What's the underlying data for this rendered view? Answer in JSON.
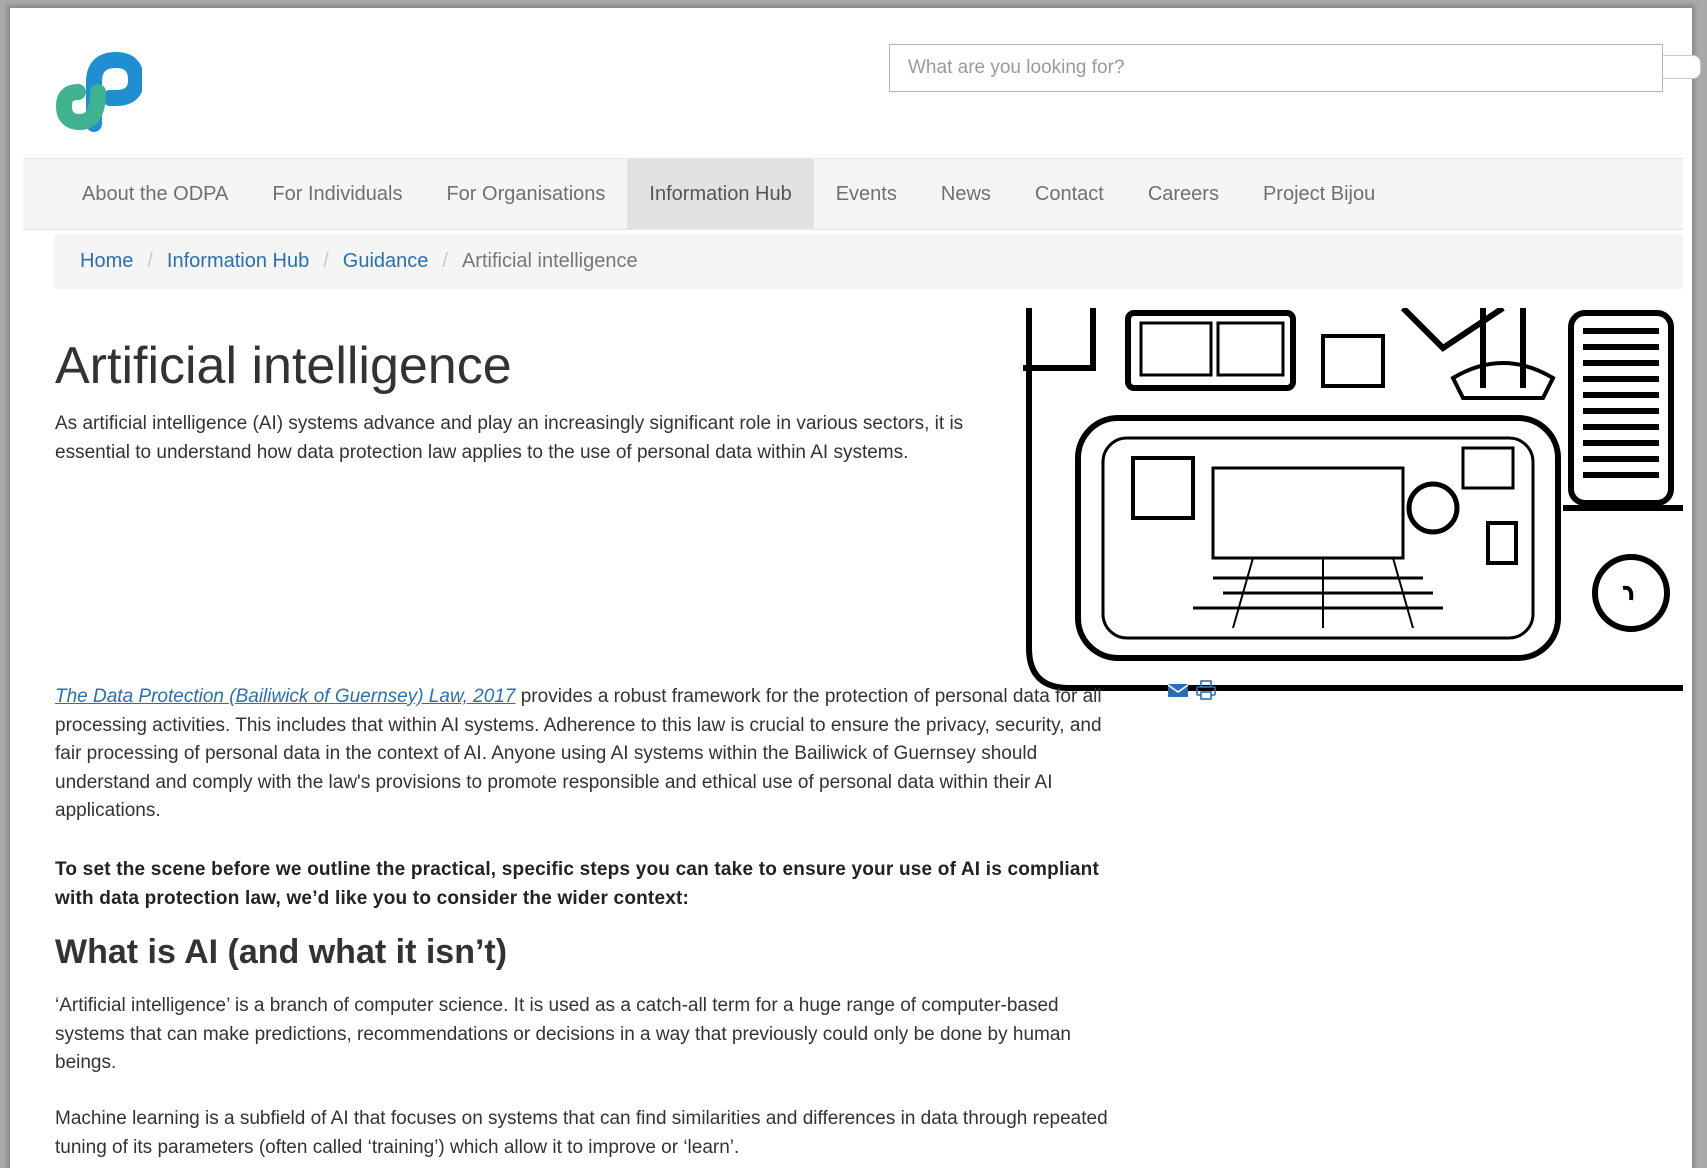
{
  "colors": {
    "link": "#2a6fb5",
    "logo_green": "#3fb28f",
    "logo_blue": "#1f8fd1"
  },
  "header": {
    "logo_icon": "odpa-logo",
    "search": {
      "placeholder": "What are you looking for?",
      "value": ""
    }
  },
  "nav": {
    "items": [
      {
        "label": "About the ODPA"
      },
      {
        "label": "For Individuals"
      },
      {
        "label": "For Organisations"
      },
      {
        "label": "Information Hub"
      },
      {
        "label": "Events"
      },
      {
        "label": "News"
      },
      {
        "label": "Contact"
      },
      {
        "label": "Careers"
      },
      {
        "label": "Project Bijou"
      }
    ],
    "active": "Information Hub"
  },
  "breadcrumb": {
    "home": "Home",
    "hub": "Information Hub",
    "guidance": "Guidance",
    "current": "Artificial intelligence",
    "separator": "/"
  },
  "main": {
    "title": "Artificial intelligence",
    "intro": "As artificial intelligence (AI) systems advance and play an increasingly significant role in various sectors, it is essential to understand how data protection law applies to the use of personal data within AI systems.",
    "law_link": "The Data Protection (Bailiwick of Guernsey) Law, 2017",
    "p1_rest": " provides a robust framework for the protection of personal data for all processing activities. This includes that within AI systems. Adherence to this law is crucial to ensure the privacy, security, and fair processing of personal data in the context of AI. Anyone using AI systems within the Bailiwick of Guernsey should understand and comply with the law's provisions to promote responsible and ethical use of personal data within their AI applications.",
    "bold_para": "To set the scene before we outline the practical, specific steps you can take to ensure your use of AI is compliant with data protection law, we’d like you to consider the wider context:",
    "h2": "What is AI (and what it isn’t)",
    "p2": "‘Artificial intelligence’ is a branch of computer science. It is used as a catch-all term for a huge range of computer-based systems that can make predictions, recommendations or decisions in a way that previously could only be done by human beings.",
    "p3": "Machine learning is a subfield of AI that focuses on systems that can find similarities and differences in data through repeated tuning of its parameters (often called ‘training’) which allow it to improve or ‘learn’."
  },
  "share": {
    "email_icon": "envelope-icon",
    "print_icon": "printer-icon"
  }
}
